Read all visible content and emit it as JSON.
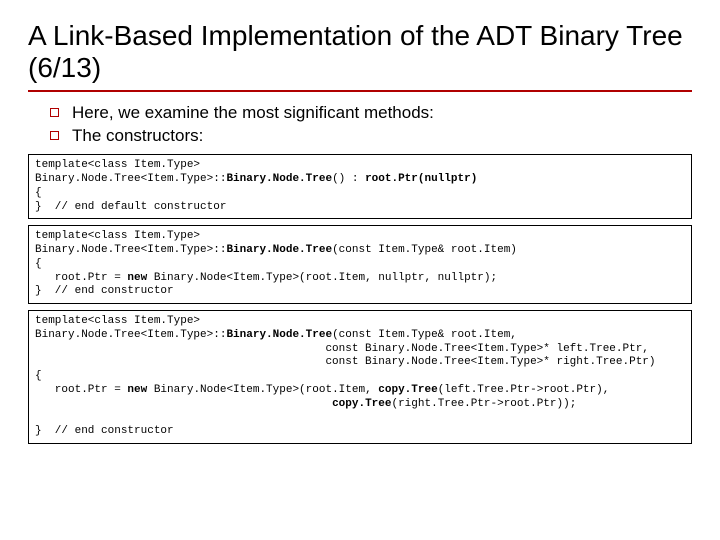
{
  "title": "A Link-Based Implementation of the ADT Binary Tree (6/13)",
  "bullets": [
    "Here, we examine the most significant methods:",
    "The constructors:"
  ],
  "code1": {
    "l1": "template<class Item.Type>",
    "l2a": "Binary.Node.Tree<Item.Type>::",
    "l2b": "Binary.Node.Tree",
    "l2c": "() : ",
    "l2d": "root.Ptr(nullptr)",
    "l3": "{",
    "l4": "}  // end default constructor"
  },
  "code2": {
    "l1": "template<class Item.Type>",
    "l2a": "Binary.Node.Tree<Item.Type>::",
    "l2b": "Binary.Node.Tree",
    "l2c": "(const Item.Type& root.Item)",
    "l3": "{",
    "l4a": "   root.Ptr = ",
    "l4b": "new",
    "l4c": " Binary.Node<Item.Type>(root.Item, nullptr, nullptr);",
    "l5": "}  // end constructor"
  },
  "code3": {
    "l1": "template<class Item.Type>",
    "l2a": "Binary.Node.Tree<Item.Type>::",
    "l2b": "Binary.Node.Tree",
    "l2c": "(const Item.Type& root.Item,",
    "l3": "                                            const Binary.Node.Tree<Item.Type>* left.Tree.Ptr,",
    "l4": "                                            const Binary.Node.Tree<Item.Type>* right.Tree.Ptr)",
    "l5": "{",
    "l6a": "   root.Ptr = ",
    "l6b": "new",
    "l6c": " Binary.Node<Item.Type>(root.Item, ",
    "l6d": "copy.Tree",
    "l6e": "(left.Tree.Ptr->root.Ptr),",
    "l7a": "                                             ",
    "l7b": "copy.Tree",
    "l7c": "(right.Tree.Ptr->root.Ptr));",
    "l8": "}  // end constructor"
  }
}
